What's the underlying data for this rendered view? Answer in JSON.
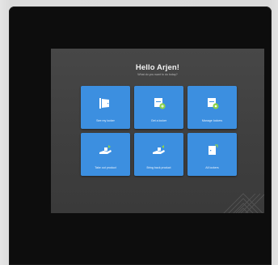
{
  "header": {
    "greeting": "Hello Arjen!",
    "subtitle": "What do you want to do today?"
  },
  "tiles": [
    {
      "label": "See my locker",
      "icon": "locker-door-icon"
    },
    {
      "label": "Get a locker",
      "icon": "locker-add-icon"
    },
    {
      "label": "Manage lockers",
      "icon": "locker-settings-icon"
    },
    {
      "label": "Take out product",
      "icon": "take-out-product-icon"
    },
    {
      "label": "Bring back product",
      "icon": "bring-back-product-icon"
    },
    {
      "label": "All lockers",
      "icon": "all-lockers-icon"
    }
  ],
  "colors": {
    "tile": "#3c8fe0",
    "accent_green": "#8bd34a",
    "screen_bg": "#434343",
    "bezel": "#0d0d0d"
  }
}
